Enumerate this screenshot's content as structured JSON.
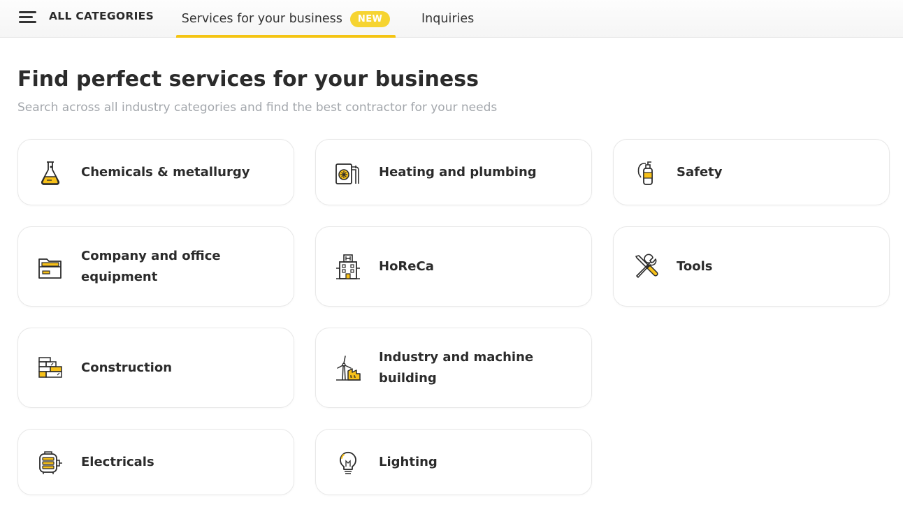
{
  "nav": {
    "all_categories": "ALL CATEGORIES",
    "tabs": [
      {
        "label": "Services for your business",
        "badge": "NEW",
        "active": true
      },
      {
        "label": "Inquiries",
        "active": false
      }
    ]
  },
  "header": {
    "title": "Find perfect services for your business",
    "subtitle": "Search across all industry categories and find the best contractor for your needs"
  },
  "categories": [
    {
      "label": "Chemicals & metallurgy",
      "icon": "flask-icon"
    },
    {
      "label": "Heating and plumbing",
      "icon": "boiler-icon"
    },
    {
      "label": "Safety",
      "icon": "fire-extinguisher-icon"
    },
    {
      "label": "Company and office equipment",
      "icon": "folder-icon"
    },
    {
      "label": "HoReCa",
      "icon": "hotel-icon"
    },
    {
      "label": "Tools",
      "icon": "tools-icon"
    },
    {
      "label": "Construction",
      "icon": "bricks-icon"
    },
    {
      "label": "Industry and machine building",
      "icon": "factory-icon"
    },
    {
      "label": "Electricals",
      "icon": "motor-icon"
    },
    {
      "label": "Lighting",
      "icon": "lightbulb-icon"
    }
  ],
  "colors": {
    "accent": "#f4c413",
    "badge": "#f6d431",
    "subtitle": "#a3a7ac",
    "icon_fill": "#f7c11a"
  }
}
